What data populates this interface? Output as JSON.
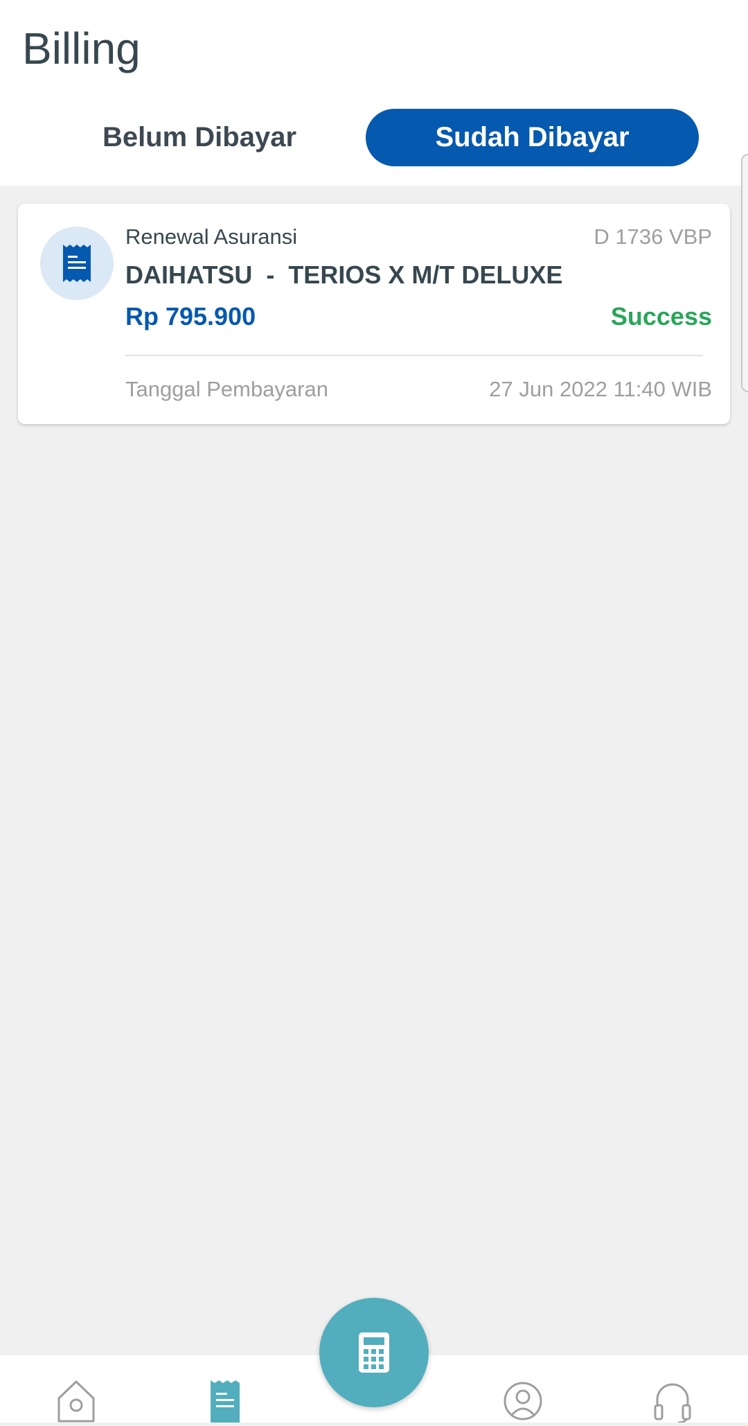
{
  "header": {
    "title": "Billing",
    "tabs": [
      {
        "label": "Belum Dibayar",
        "active": false
      },
      {
        "label": "Sudah Dibayar",
        "active": true
      }
    ]
  },
  "billing_items": [
    {
      "category": "Renewal Asuransi",
      "plate": "D 1736 VBP",
      "vehicle": "DAIHATSU  -  TERIOS X M/T DELUXE",
      "amount": "Rp 795.900",
      "status": "Success",
      "payment_date_label": "Tanggal Pembayaran",
      "payment_date": "27 Jun 2022 11:40 WIB",
      "icon": "receipt-icon"
    }
  ],
  "bottom_nav": {
    "items": [
      {
        "icon": "home-icon",
        "active": false
      },
      {
        "icon": "receipt-icon",
        "active": true
      },
      {
        "icon": "calculator-icon",
        "active": false
      },
      {
        "icon": "account-icon",
        "active": false
      },
      {
        "icon": "headset-icon",
        "active": false
      }
    ]
  },
  "colors": {
    "primary": "#0559ae",
    "accent": "#52aebc",
    "success": "#2aa55a",
    "text": "#37474f",
    "muted": "#9e9e9e",
    "background": "#f0f0f0"
  }
}
